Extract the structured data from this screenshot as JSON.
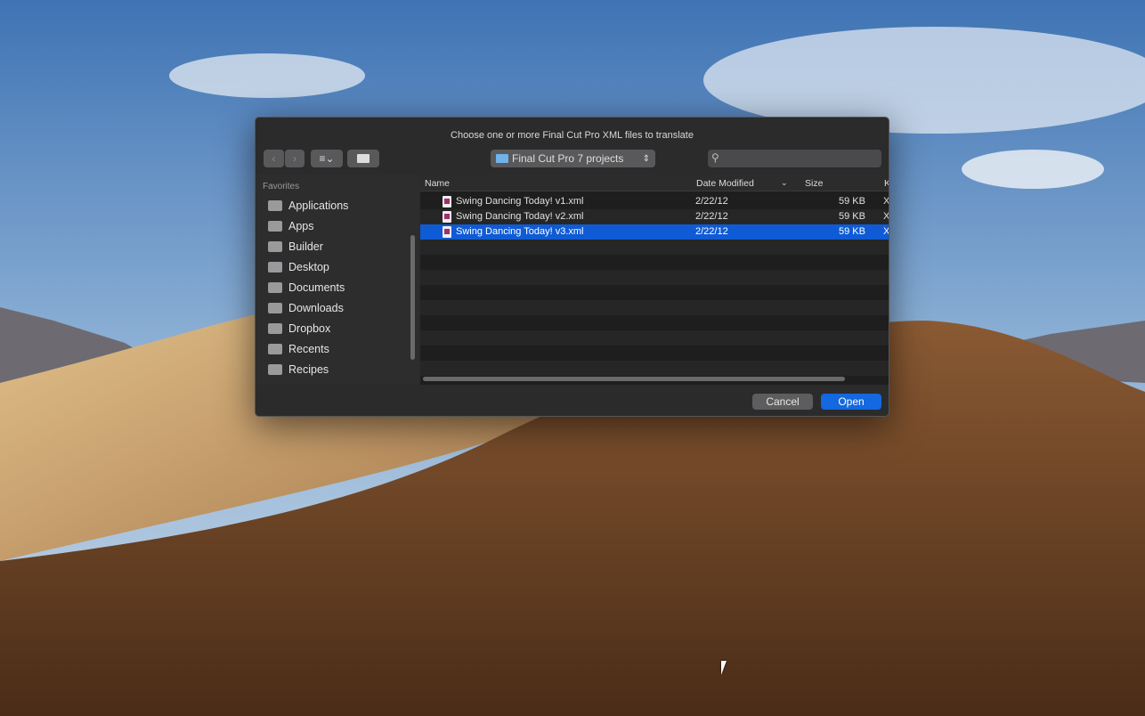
{
  "dialog": {
    "title": "Choose one or more Final Cut Pro XML files to translate",
    "toolbar": {
      "location": "Final Cut Pro 7 projects",
      "search_placeholder": ""
    },
    "sidebar": {
      "section": "Favorites",
      "items": [
        {
          "label": "Applications",
          "icon": "applications-icon"
        },
        {
          "label": "Apps",
          "icon": "folder-icon"
        },
        {
          "label": "Builder",
          "icon": "folder-icon"
        },
        {
          "label": "Desktop",
          "icon": "desktop-icon"
        },
        {
          "label": "Documents",
          "icon": "documents-icon"
        },
        {
          "label": "Downloads",
          "icon": "downloads-icon"
        },
        {
          "label": "Dropbox",
          "icon": "folder-icon"
        },
        {
          "label": "Recents",
          "icon": "recents-icon"
        },
        {
          "label": "Recipes",
          "icon": "folder-icon"
        }
      ]
    },
    "columns": {
      "name": "Name",
      "date": "Date Modified",
      "size": "Size",
      "kind": "K"
    },
    "files": [
      {
        "name": "Swing Dancing Today! v1.xml",
        "date": "2/22/12",
        "size": "59 KB",
        "kind": "XI"
      },
      {
        "name": "Swing Dancing Today! v2.xml",
        "date": "2/22/12",
        "size": "59 KB",
        "kind": "XI"
      },
      {
        "name": "Swing Dancing Today! v3.xml",
        "date": "2/22/12",
        "size": "59 KB",
        "kind": "XI",
        "selected": true
      }
    ],
    "buttons": {
      "cancel": "Cancel",
      "open": "Open"
    },
    "accent": "#0f5bd5"
  }
}
